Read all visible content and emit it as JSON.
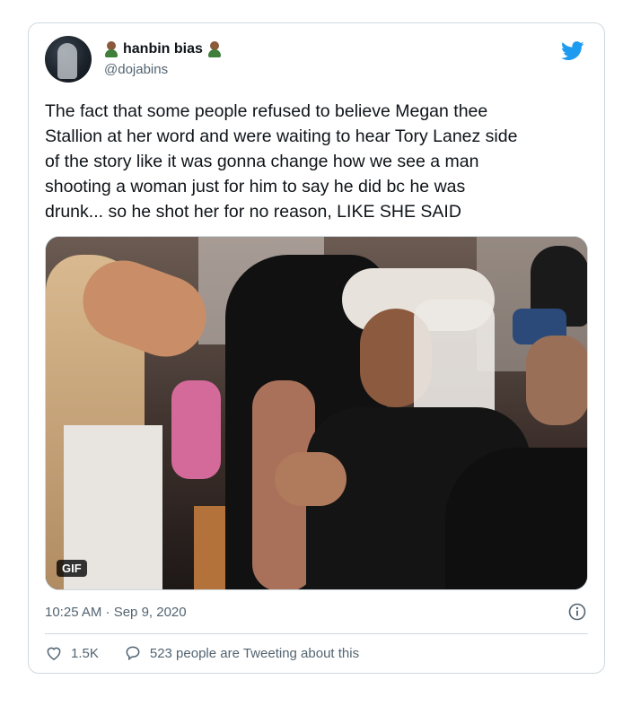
{
  "user": {
    "display_name": "hanbin bias",
    "handle": "@dojabins",
    "avatar_icon": "profile-photo"
  },
  "brand": {
    "icon": "twitter-bird-icon",
    "color": "#1d9bf0"
  },
  "tweet": {
    "text": "The fact that some people refused to believe Megan thee\nStallion at her word and were waiting to hear Tory Lanez side\nof the story like it was gonna change how we see a man\nshooting a woman just for him to say he did bc he was\ndrunk... so he shot her for no reason, LIKE SHE SAID"
  },
  "media": {
    "badge": "GIF"
  },
  "meta": {
    "timestamp": "10:25 AM · Sep 9, 2020",
    "info_icon": "info-icon"
  },
  "actions": {
    "likes": "1.5K",
    "conversation": "523 people are Tweeting about this",
    "like_icon": "heart-icon",
    "reply_icon": "speech-bubble-icon"
  }
}
